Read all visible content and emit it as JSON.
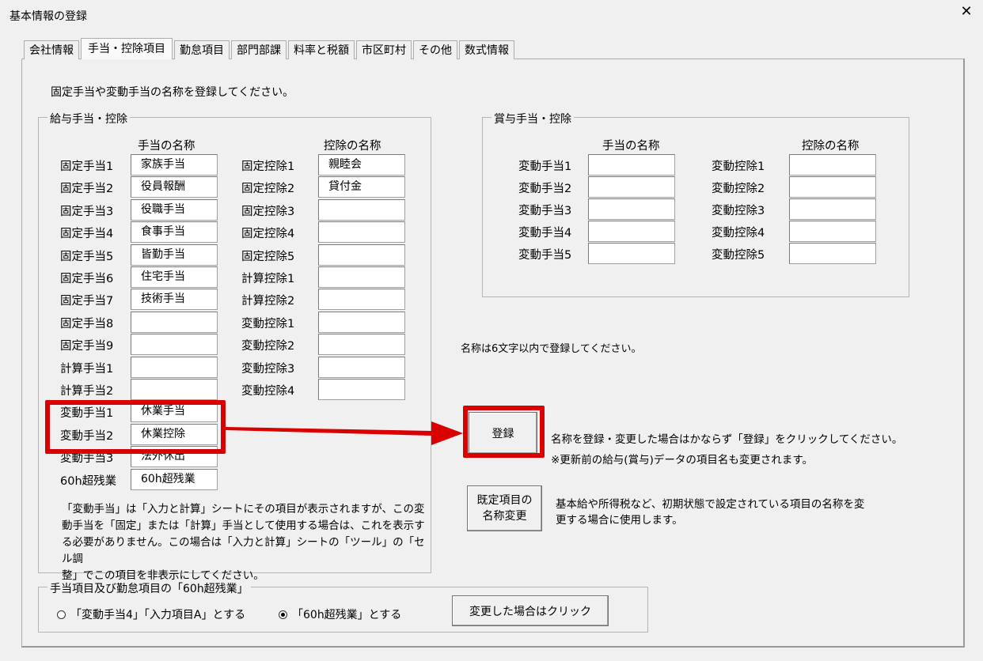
{
  "window": {
    "title": "基本情報の登録",
    "close_glyph": "✕"
  },
  "tabs": [
    "会社情報",
    "手当・控除項目",
    "勤怠項目",
    "部門部課",
    "料率と税額",
    "市区町村",
    "その他",
    "数式情報"
  ],
  "active_tab": 1,
  "instruction": "固定手当や変動手当の名称を登録してください。",
  "salary": {
    "legend": "給与手当・控除",
    "allow_header": "手当の名称",
    "deduct_header": "控除の名称",
    "allowances": [
      {
        "label": "固定手当1",
        "value": "家族手当"
      },
      {
        "label": "固定手当2",
        "value": "役員報酬"
      },
      {
        "label": "固定手当3",
        "value": "役職手当"
      },
      {
        "label": "固定手当4",
        "value": "食事手当"
      },
      {
        "label": "固定手当5",
        "value": "皆勤手当"
      },
      {
        "label": "固定手当6",
        "value": "住宅手当"
      },
      {
        "label": "固定手当7",
        "value": "技術手当"
      },
      {
        "label": "固定手当8",
        "value": ""
      },
      {
        "label": "固定手当9",
        "value": ""
      },
      {
        "label": "計算手当1",
        "value": ""
      },
      {
        "label": "計算手当2",
        "value": ""
      },
      {
        "label": "変動手当1",
        "value": "休業手当"
      },
      {
        "label": "変動手当2",
        "value": "休業控除"
      },
      {
        "label": "変動手当3",
        "value": "法外休出"
      },
      {
        "label": "60h超残業",
        "value": "60h超残業"
      }
    ],
    "deductions": [
      {
        "label": "固定控除1",
        "value": "親睦会"
      },
      {
        "label": "固定控除2",
        "value": "貸付金"
      },
      {
        "label": "固定控除3",
        "value": ""
      },
      {
        "label": "固定控除4",
        "value": ""
      },
      {
        "label": "固定控除5",
        "value": ""
      },
      {
        "label": "計算控除1",
        "value": ""
      },
      {
        "label": "計算控除2",
        "value": ""
      },
      {
        "label": "変動控除1",
        "value": ""
      },
      {
        "label": "変動控除2",
        "value": ""
      },
      {
        "label": "変動控除3",
        "value": ""
      },
      {
        "label": "変動控除4",
        "value": ""
      }
    ],
    "note_lines": [
      "「変動手当」は「入力と計算」シートにその項目が表示されますが、この変",
      "動手当を「固定」または「計算」手当として使用する場合は、これを表示す",
      "る必要がありません。この場合は「入力と計算」シートの「ツール」の「セル調",
      "整」でこの項目を非表示にしてください。"
    ]
  },
  "bonus": {
    "legend": "賞与手当・控除",
    "allow_header": "手当の名称",
    "deduct_header": "控除の名称",
    "allowances": [
      {
        "label": "変動手当1",
        "value": ""
      },
      {
        "label": "変動手当2",
        "value": ""
      },
      {
        "label": "変動手当3",
        "value": ""
      },
      {
        "label": "変動手当4",
        "value": ""
      },
      {
        "label": "変動手当5",
        "value": ""
      }
    ],
    "deductions": [
      {
        "label": "変動控除1",
        "value": ""
      },
      {
        "label": "変動控除2",
        "value": ""
      },
      {
        "label": "変動控除3",
        "value": ""
      },
      {
        "label": "変動控除4",
        "value": ""
      },
      {
        "label": "変動控除5",
        "value": ""
      }
    ]
  },
  "limit_note": "名称は6文字以内で登録してください。",
  "register": {
    "button": "登録",
    "desc1": "名称を登録・変更した場合はかならず「登録」をクリックしてください。",
    "desc2": "※更新前の給与(賞与)データの項目名も変更されます。"
  },
  "default_names": {
    "button_line1": "既定項目の",
    "button_line2": "名称変更",
    "desc1": "基本給や所得税など、初期状態で設定されている項目の名称を変",
    "desc2": "更する場合に使用します。"
  },
  "overtime": {
    "legend": "手当項目及び勤怠項目の「60h超残業」",
    "option1": "「変動手当4」「入力項目A」とする",
    "option2": "「60h超残業」とする",
    "selected": 2,
    "button": "変更した場合はクリック"
  },
  "colors": {
    "highlight": "#d90000",
    "bg": "#f0f0f0"
  }
}
